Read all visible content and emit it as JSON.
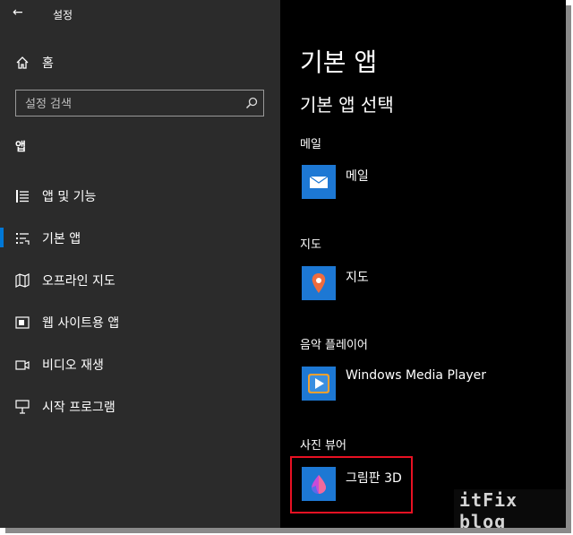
{
  "window": {
    "title": "설정",
    "back_icon": "arrow-left-icon"
  },
  "sidebar": {
    "home_label": "홈",
    "search_placeholder": "설정 검색",
    "section_title": "앱",
    "items": [
      {
        "label": "앱 및 기능",
        "icon": "apps-list-icon",
        "selected": false
      },
      {
        "label": "기본 앱",
        "icon": "default-apps-icon",
        "selected": true
      },
      {
        "label": "오프라인 지도",
        "icon": "offline-map-icon",
        "selected": false
      },
      {
        "label": "웹 사이트용 앱",
        "icon": "website-app-icon",
        "selected": false
      },
      {
        "label": "비디오 재생",
        "icon": "video-icon",
        "selected": false
      },
      {
        "label": "시작 프로그램",
        "icon": "startup-icon",
        "selected": false
      }
    ]
  },
  "main": {
    "title": "기본 앱",
    "subtitle": "기본 앱 선택",
    "categories": [
      {
        "label": "메일",
        "app": "메일"
      },
      {
        "label": "지도",
        "app": "지도"
      },
      {
        "label": "음악 플레이어",
        "app": "Windows Media Player"
      },
      {
        "label": "사진 뷰어",
        "app": "그림판 3D"
      }
    ]
  },
  "colors": {
    "accent": "#0078d7",
    "tile": "#1d78d4",
    "highlight": "#e81123"
  },
  "watermark": "itFix blog"
}
